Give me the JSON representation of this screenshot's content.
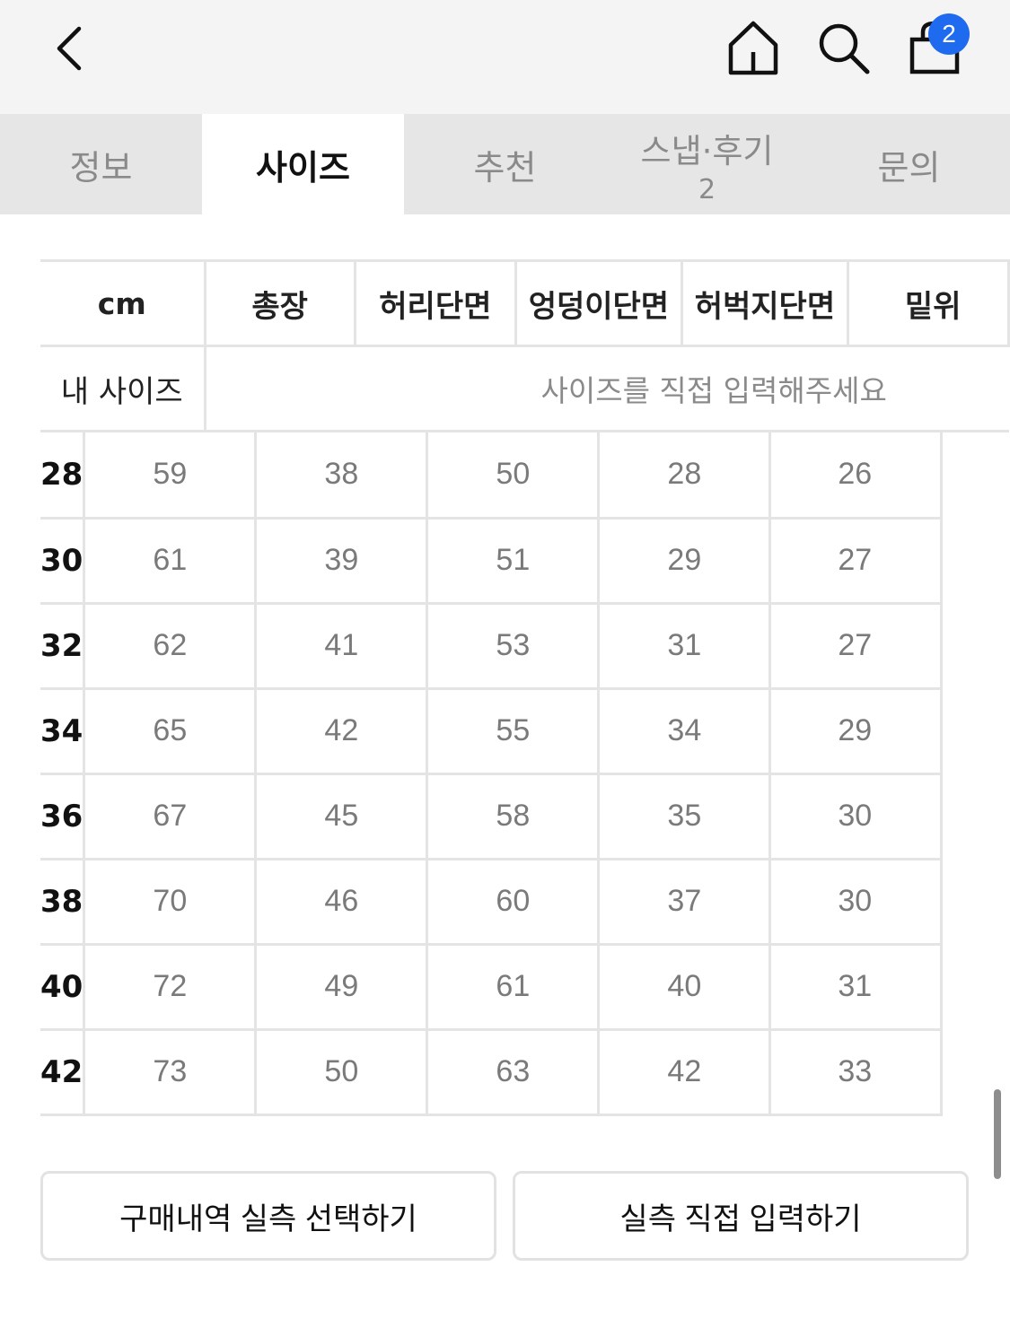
{
  "header": {
    "cart_count": "2",
    "icons": [
      "chevron-left-icon",
      "home-icon",
      "search-icon",
      "shopping-bag-icon"
    ]
  },
  "tabs": [
    {
      "label": "정보",
      "count": ""
    },
    {
      "label": "사이즈",
      "count": "",
      "active": true
    },
    {
      "label": "추천",
      "count": ""
    },
    {
      "label": "스냅·후기",
      "count": "2"
    },
    {
      "label": "문의",
      "count": ""
    }
  ],
  "size_table": {
    "unit": "cm",
    "columns": [
      "총장",
      "허리단면",
      "엉덩이단면",
      "허벅지단면",
      "밑위"
    ],
    "my_size_label": "내 사이즈",
    "my_size_placeholder": "사이즈를 직접 입력해주세요",
    "rows": [
      {
        "size": "28",
        "values": [
          "59",
          "38",
          "50",
          "28",
          "26"
        ]
      },
      {
        "size": "30",
        "values": [
          "61",
          "39",
          "51",
          "29",
          "27"
        ]
      },
      {
        "size": "32",
        "values": [
          "62",
          "41",
          "53",
          "31",
          "27"
        ]
      },
      {
        "size": "34",
        "values": [
          "65",
          "42",
          "55",
          "34",
          "29"
        ]
      },
      {
        "size": "36",
        "values": [
          "67",
          "45",
          "58",
          "35",
          "30"
        ]
      },
      {
        "size": "38",
        "values": [
          "70",
          "46",
          "60",
          "37",
          "30"
        ]
      },
      {
        "size": "40",
        "values": [
          "72",
          "49",
          "61",
          "40",
          "31"
        ]
      },
      {
        "size": "42",
        "values": [
          "73",
          "50",
          "63",
          "42",
          "33"
        ]
      }
    ]
  },
  "actions": {
    "purchase_history_label": "구매내역 실측 선택하기",
    "direct_input_label": "실측 직접 입력하기"
  },
  "colors": {
    "badge": "#1f6bf0",
    "topbar": "#f4f4f4",
    "tabbar": "#e6e6e6"
  }
}
